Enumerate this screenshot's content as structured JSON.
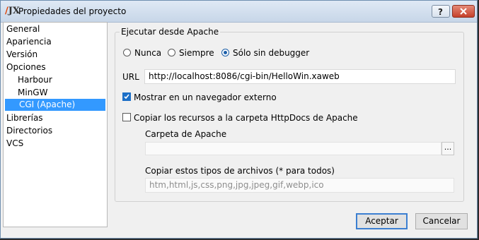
{
  "window": {
    "title": "Propiedades del proyecto",
    "icon_text": "JX",
    "help_button": "help-icon",
    "close_button": "close-icon"
  },
  "tree": {
    "items": [
      {
        "label": "General",
        "level": 0
      },
      {
        "label": "Apariencia",
        "level": 0
      },
      {
        "label": "Versión",
        "level": 0
      },
      {
        "label": "Opciones",
        "level": 0
      },
      {
        "label": "Harbour",
        "level": 1
      },
      {
        "label": "MinGW",
        "level": 1
      },
      {
        "label": "CGI (Apache)",
        "level": 1,
        "selected": true
      },
      {
        "label": "Librerías",
        "level": 0
      },
      {
        "label": "Directorios",
        "level": 0
      },
      {
        "label": "VCS",
        "level": 0
      }
    ]
  },
  "panel": {
    "group_title": "Ejecutar desde Apache",
    "radios": [
      {
        "label": "Nunca",
        "checked": false
      },
      {
        "label": "Siempre",
        "checked": false
      },
      {
        "label": "Sólo sin debugger",
        "checked": true
      }
    ],
    "url_label": "URL",
    "url_value": "http://localhost:8086/cgi-bin/HelloWin.xaweb",
    "open_browser": {
      "label": "Mostrar en un navegador externo",
      "checked": true
    },
    "copy_resources": {
      "label": "Copiar los recursos a la carpeta HttpDocs de Apache",
      "checked": false
    },
    "apache_folder_label": "Carpeta de Apache",
    "apache_folder_value": "",
    "browse_label": "...",
    "file_types_label": "Copiar estos tipos de archivos (* para todos)",
    "file_types_value": "htm,html,js,css,png,jpg,jpeg,gif,webp,ico"
  },
  "buttons": {
    "accept": "Aceptar",
    "cancel": "Cancelar"
  },
  "colors": {
    "selection": "#3399ff",
    "checkbox_accent": "#1c6fc7"
  }
}
